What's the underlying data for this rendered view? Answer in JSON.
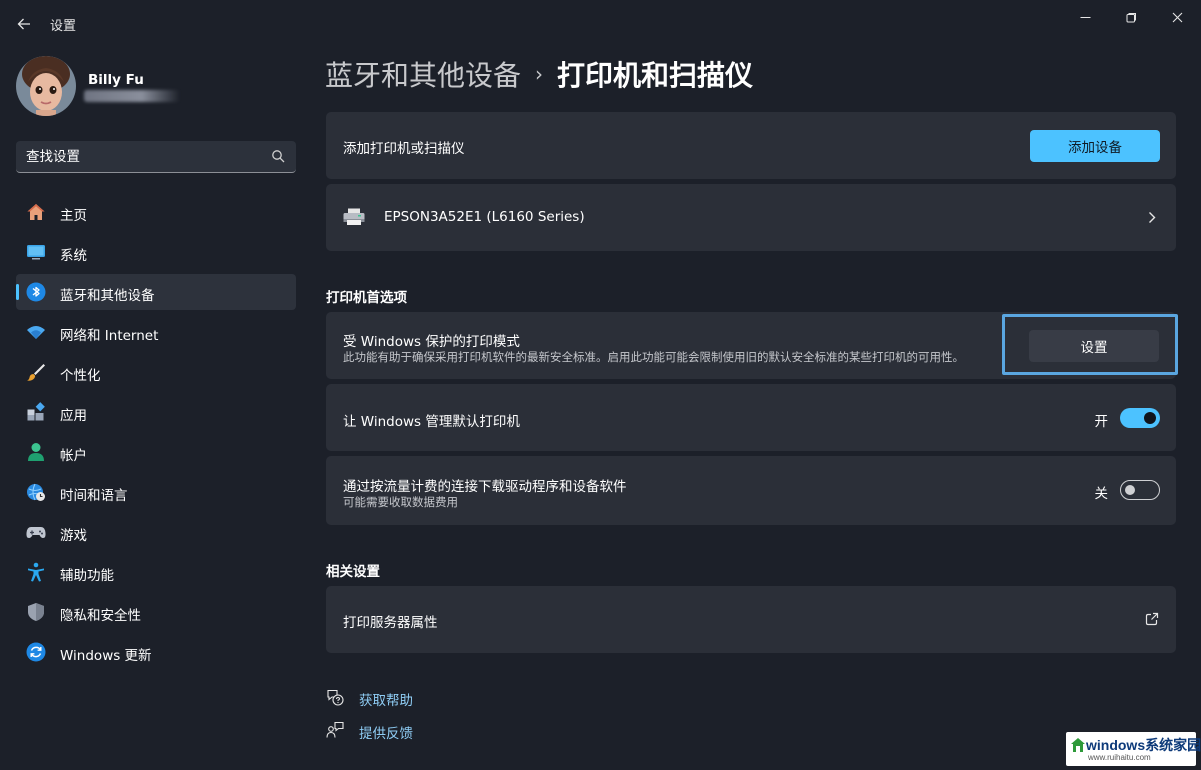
{
  "window": {
    "title": "设置",
    "back_icon": "arrow-left-icon",
    "controls": [
      "minimize-icon",
      "restore-icon",
      "close-icon"
    ]
  },
  "profile": {
    "name": "Billy Fu"
  },
  "search": {
    "placeholder": "查找设置"
  },
  "sidebar": {
    "items": [
      {
        "label": "主页",
        "icon": "home-icon"
      },
      {
        "label": "系统",
        "icon": "monitor-icon"
      },
      {
        "label": "蓝牙和其他设备",
        "icon": "bluetooth-icon",
        "active": true
      },
      {
        "label": "网络和 Internet",
        "icon": "wifi-icon"
      },
      {
        "label": "个性化",
        "icon": "brush-icon"
      },
      {
        "label": "应用",
        "icon": "apps-icon"
      },
      {
        "label": "帐户",
        "icon": "person-icon"
      },
      {
        "label": "时间和语言",
        "icon": "globe-clock-icon"
      },
      {
        "label": "游戏",
        "icon": "gamepad-icon"
      },
      {
        "label": "辅助功能",
        "icon": "accessibility-icon"
      },
      {
        "label": "隐私和安全性",
        "icon": "shield-icon"
      },
      {
        "label": "Windows 更新",
        "icon": "update-icon"
      }
    ]
  },
  "breadcrumb": {
    "parent": "蓝牙和其他设备",
    "separator": "›",
    "current": "打印机和扫描仪"
  },
  "add_device": {
    "label": "添加打印机或扫描仪",
    "button": "添加设备"
  },
  "printer": {
    "name": "EPSON3A52E1 (L6160 Series)",
    "icon": "printer-icon"
  },
  "preferences": {
    "heading": "打印机首选项",
    "protected_mode": {
      "title": "受 Windows 保护的打印模式",
      "description": "此功能有助于确保采用打印机软件的最新安全标准。启用此功能可能会限制使用旧的默认安全标准的某些打印机的可用性。",
      "button": "设置"
    },
    "manage_default": {
      "title": "让 Windows 管理默认打印机",
      "state": "开",
      "on": true
    },
    "metered": {
      "title": "通过按流量计费的连接下载驱动程序和设备软件",
      "description": "可能需要收取数据费用",
      "state": "关",
      "on": false
    }
  },
  "related": {
    "heading": "相关设置",
    "print_server": {
      "label": "打印服务器属性",
      "icon": "external-link-icon"
    }
  },
  "footer": {
    "help": "获取帮助",
    "feedback": "提供反馈"
  },
  "watermark": {
    "text": "windows系统家园",
    "url": "www.ruihaitu.com"
  },
  "colors": {
    "accent": "#4cc2ff",
    "background": "#1c2029",
    "card": "#2b2f38",
    "link": "#8fcdf5"
  }
}
